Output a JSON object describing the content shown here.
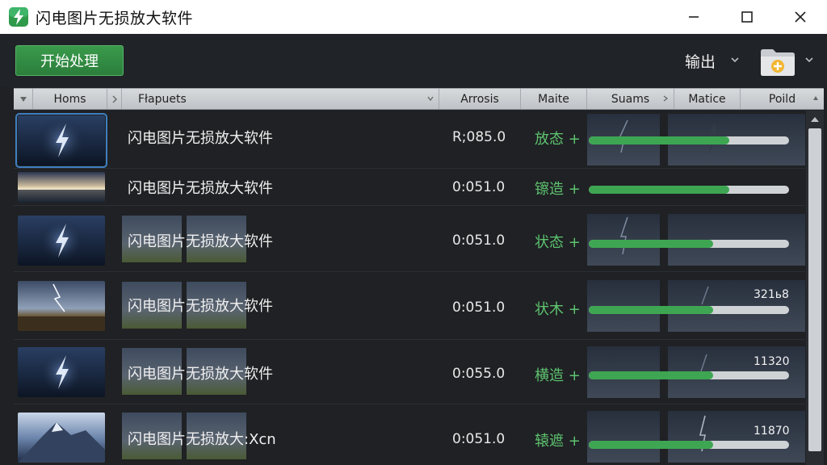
{
  "window": {
    "title": "闪电图片无损放大软件",
    "controls": [
      "minimize",
      "maximize",
      "close"
    ]
  },
  "toolbar": {
    "start_label": "开始处理",
    "output_label": "输出",
    "folder_icon": "folder-add-icon"
  },
  "columns": [
    "Homs",
    "Fłapuets",
    "Arrosis",
    "Maite",
    "Suams",
    "Matice",
    "Poild"
  ],
  "rows": [
    {
      "name": "闪电图片无损放大软件",
      "time": "R;085.0",
      "status": "放态 +",
      "progress": 0.7,
      "count": "",
      "thumb": "lightning",
      "selected": true
    },
    {
      "name": "闪电图片无损放大软件",
      "time": "0:051.0",
      "status": "镲造 +",
      "progress": 0.7,
      "count": "",
      "thumb": "sunset",
      "selected": false
    },
    {
      "name": "闪电图片无损放大软件",
      "time": "0:051.0",
      "status": "状态 +",
      "progress": 0.62,
      "count": "",
      "thumb": "lightning",
      "selected": false
    },
    {
      "name": "闪电图片无损放大软件",
      "time": "0:051.0",
      "status": "状木 +",
      "progress": 0.62,
      "count": "321ь8",
      "thumb": "storm-field",
      "selected": false
    },
    {
      "name": "闪电图片无损放大软件",
      "time": "0:055.0",
      "status": "横造 +",
      "progress": 0.62,
      "count": "11320",
      "thumb": "lightning",
      "selected": false
    },
    {
      "name": "闪电图片无损放大:Xcn",
      "time": "0:051.0",
      "status": "辕遮 +",
      "progress": 0.62,
      "count": "11870",
      "thumb": "mountain",
      "selected": false
    }
  ],
  "colors": {
    "accent": "#3ea652",
    "status_text": "#5ec36f",
    "selection": "#3f7fc1",
    "background": "#1f2124"
  }
}
